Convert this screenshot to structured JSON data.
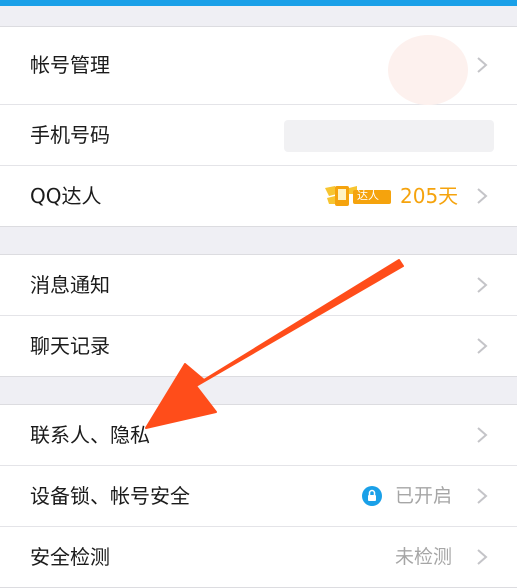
{
  "colors": {
    "accent": "#1aa0e8",
    "orange": "#f5a30d",
    "arrow": "#ff4d1a",
    "lock": "#1aa0e8"
  },
  "groups": [
    {
      "items": [
        {
          "label": "帐号管理"
        },
        {
          "label": "手机号码"
        },
        {
          "label": "QQ达人",
          "badge_text": "达人",
          "value": "205天"
        }
      ]
    },
    {
      "items": [
        {
          "label": "消息通知"
        },
        {
          "label": "聊天记录"
        }
      ]
    },
    {
      "items": [
        {
          "label": "联系人、隐私"
        },
        {
          "label": "设备锁、帐号安全",
          "value": "已开启",
          "icon": "lock-icon"
        },
        {
          "label": "安全检测",
          "value": "未检测"
        }
      ]
    }
  ]
}
